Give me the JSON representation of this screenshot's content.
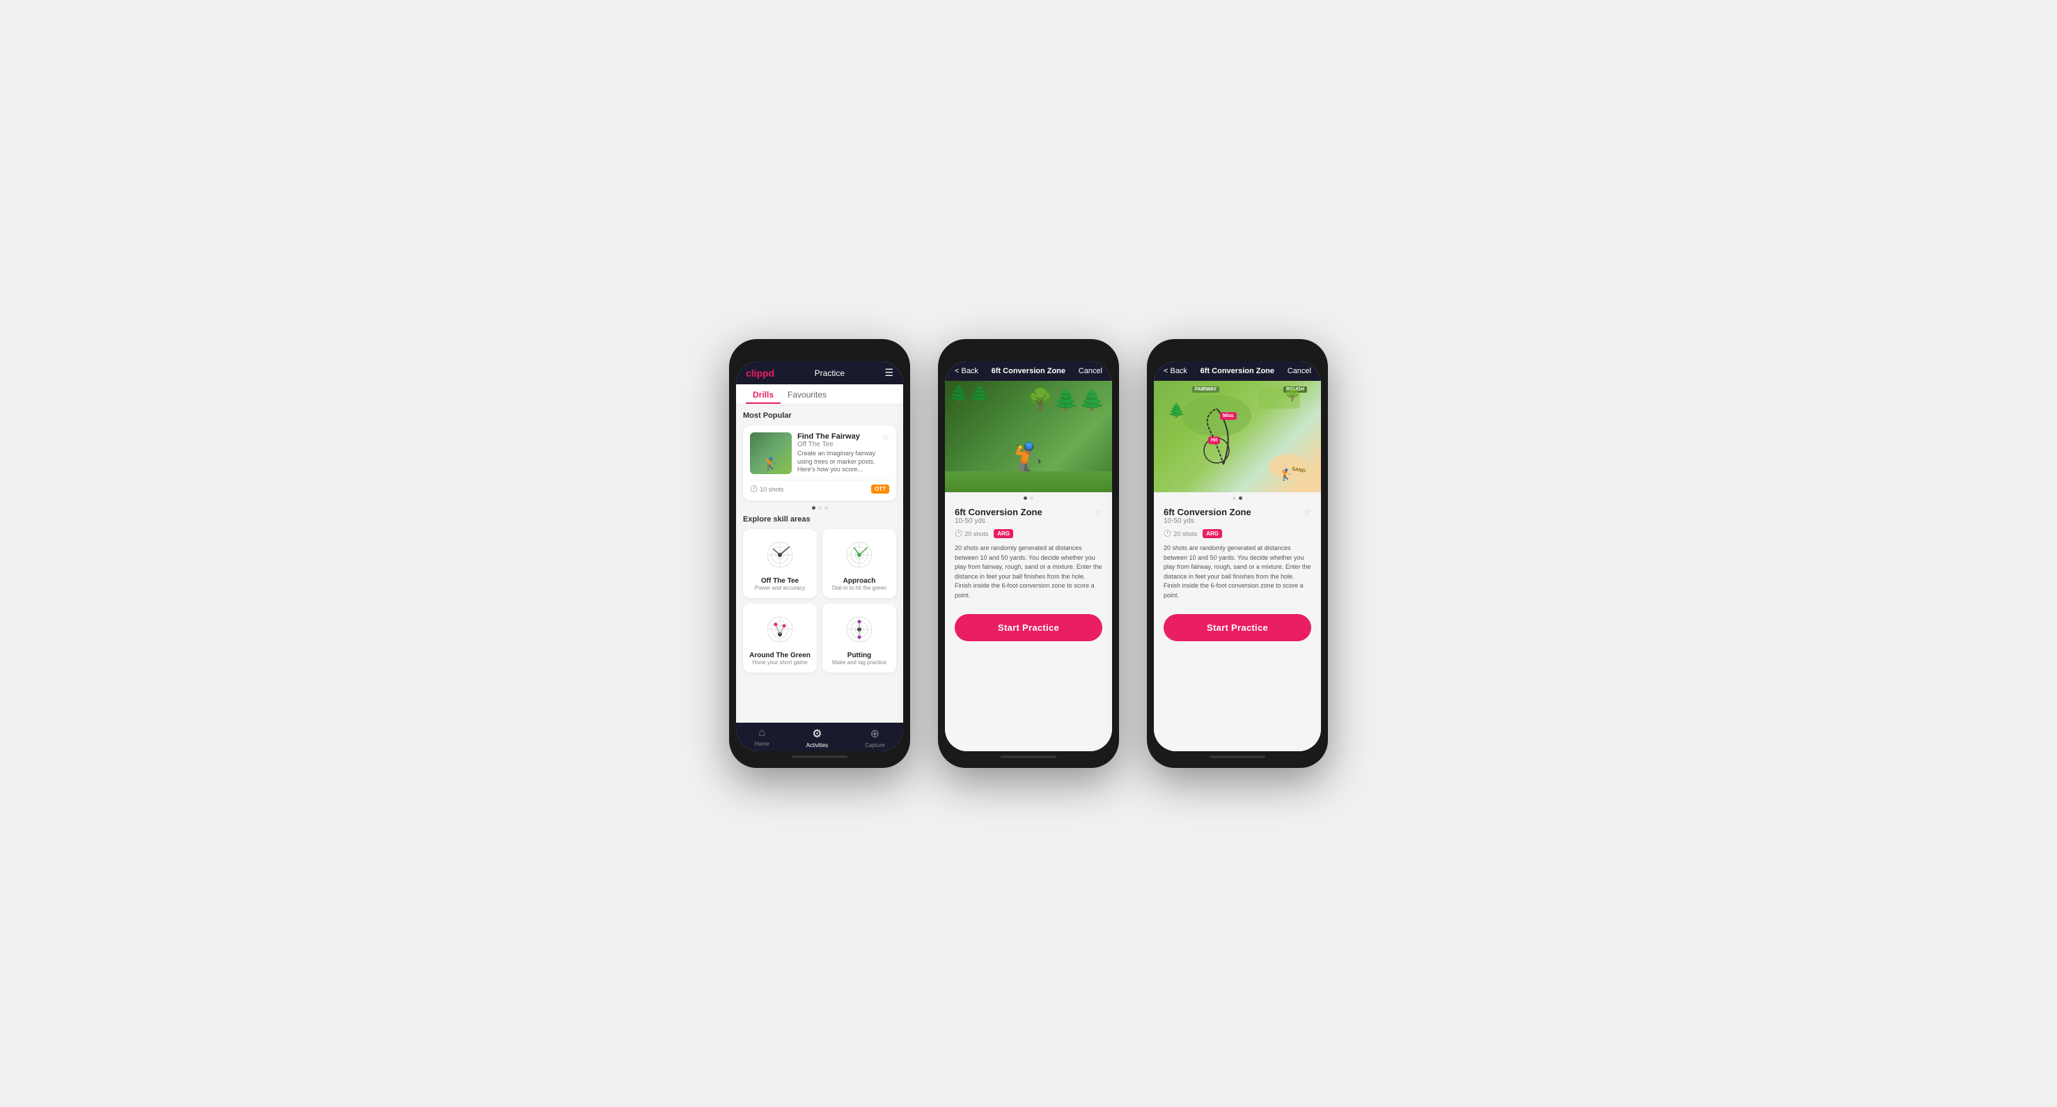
{
  "phone1": {
    "header": {
      "logo": "clippd",
      "title": "Practice",
      "menu_icon": "☰"
    },
    "tabs": [
      {
        "label": "Drills",
        "active": true
      },
      {
        "label": "Favourites",
        "active": false
      }
    ],
    "most_popular_label": "Most Popular",
    "featured_drill": {
      "title": "Find The Fairway",
      "subtitle": "Off The Tee",
      "desc": "Create an imaginary fairway using trees or marker posts. Here's how you score...",
      "shots": "10 shots",
      "badge": "OTT"
    },
    "explore_label": "Explore skill areas",
    "skills": [
      {
        "name": "Off The Tee",
        "sub": "Power and accuracy"
      },
      {
        "name": "Approach",
        "sub": "Dial-in to hit the green"
      },
      {
        "name": "Around The Green",
        "sub": "Hone your short game"
      },
      {
        "name": "Putting",
        "sub": "Make and lag practice"
      }
    ],
    "nav": [
      {
        "label": "Home",
        "icon": "🏠",
        "active": false
      },
      {
        "label": "Activities",
        "icon": "🎯",
        "active": true
      },
      {
        "label": "Capture",
        "icon": "➕",
        "active": false
      }
    ]
  },
  "phone2": {
    "header": {
      "back": "< Back",
      "title": "6ft Conversion Zone",
      "cancel": "Cancel"
    },
    "drill": {
      "title": "6ft Conversion Zone",
      "yds": "10-50 yds",
      "shots": "20 shots",
      "badge": "ARG",
      "desc": "20 shots are randomly generated at distances between 10 and 50 yards. You decide whether you play from fairway, rough, sand or a mixture. Enter the distance in feet your ball finishes from the hole. Finish inside the 6-foot conversion zone to score a point."
    },
    "start_button": "Start Practice",
    "dots": [
      true,
      false,
      false
    ]
  },
  "phone3": {
    "header": {
      "back": "< Back",
      "title": "6ft Conversion Zone",
      "cancel": "Cancel"
    },
    "drill": {
      "title": "6ft Conversion Zone",
      "yds": "10-50 yds",
      "shots": "20 shots",
      "badge": "ARG",
      "desc": "20 shots are randomly generated at distances between 10 and 50 yards. You decide whether you play from fairway, rough, sand or a mixture. Enter the distance in feet your ball finishes from the hole. Finish inside the 6-foot conversion zone to score a point."
    },
    "map_labels": {
      "miss": "Miss",
      "hit": "Hit",
      "fairway": "FAIRWAY",
      "rough": "ROUGH",
      "sand": "SAND"
    },
    "start_button": "Start Practice",
    "dots": [
      false,
      true,
      false
    ]
  }
}
